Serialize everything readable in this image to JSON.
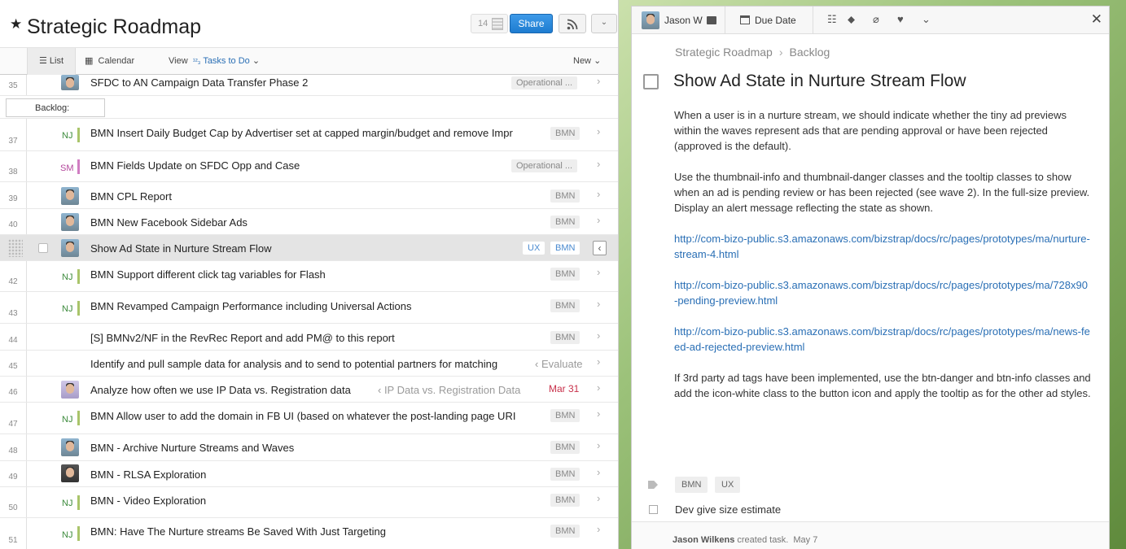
{
  "project": {
    "title": "Strategic Roadmap",
    "followers": "14",
    "share": "Share"
  },
  "toolbar": {
    "list": "List",
    "calendar": "Calendar",
    "view": "View",
    "view_filter": "Tasks to Do",
    "new": "New"
  },
  "section": {
    "backlog": "Backlog:"
  },
  "rows": [
    {
      "num": "35",
      "name": "SFDC to AN Campaign Data Transfer Phase 2",
      "tag": "Operational ..."
    },
    {
      "num": "37",
      "initials": "NJ",
      "name": "BMN Insert Daily Budget Cap by Advertiser set at capped margin/budget and remove Impr",
      "tag": "BMN"
    },
    {
      "num": "38",
      "initials": "SM",
      "name": "BMN Fields Update on SFDC Opp and Case",
      "tag": "Operational ..."
    },
    {
      "num": "39",
      "name": "BMN CPL Report",
      "tag": "BMN"
    },
    {
      "num": "40",
      "name": "BMN New Facebook Sidebar Ads",
      "tag": "BMN"
    },
    {
      "num": "",
      "name": "Show Ad State in Nurture Stream Flow",
      "tag_ux": "UX",
      "tag": "BMN"
    },
    {
      "num": "42",
      "initials": "NJ",
      "name": "BMN Support different click tag variables for Flash",
      "tag": "BMN"
    },
    {
      "num": "43",
      "initials": "NJ",
      "name": "BMN Revamped Campaign Performance including Universal Actions",
      "tag": "BMN"
    },
    {
      "num": "44",
      "name": "[S] BMNv2/NF in the RevRec Report and add PM@ to this report",
      "tag": "BMN"
    },
    {
      "num": "45",
      "name": "Identify and pull sample data for analysis and to send to potential partners for matching",
      "context": "‹ Evaluate"
    },
    {
      "num": "46",
      "name": "Analyze how often we use IP Data vs. Registration data",
      "context": "‹ IP Data vs. Registration Data",
      "date": "Mar 31"
    },
    {
      "num": "47",
      "initials": "NJ",
      "name": "BMN Allow user to add the domain in FB UI (based on whatever the post-landing page URI",
      "tag": "BMN"
    },
    {
      "num": "48",
      "name": "BMN - Archive Nurture Streams and Waves",
      "tag": "BMN"
    },
    {
      "num": "49",
      "name": "BMN - RLSA Exploration",
      "tag": "BMN"
    },
    {
      "num": "50",
      "initials": "NJ",
      "name": "BMN - Video Exploration",
      "tag": "BMN"
    },
    {
      "num": "51",
      "initials": "NJ",
      "name": "BMN: Have The Nurture streams Be Saved With Just Targeting",
      "tag": "BMN"
    }
  ],
  "detail": {
    "assignee": "Jason W",
    "due_date": "Due Date",
    "breadcrumb_project": "Strategic Roadmap",
    "breadcrumb_section": "Backlog",
    "title": "Show Ad State in Nurture Stream Flow",
    "p1": "When a user is in a nurture stream, we should indicate whether the tiny ad previews within the waves represent ads that are pending approval or have been rejected (approved is the default).",
    "p2": "Use the thumbnail-info and thumbnail-danger classes and the tooltip classes to show when an ad is pending review or has been rejected (see wave 2). In the full-size preview. Display an alert message reflecting the state as shown.",
    "link1": "http://com-bizo-public.s3.amazonaws.com/bizstrap/docs/rc/pages/prototypes/ma/nurture-stream-4.html",
    "link2": "http://com-bizo-public.s3.amazonaws.com/bizstrap/docs/rc/pages/prototypes/ma/728x90-pending-preview.html",
    "link3": "http://com-bizo-public.s3.amazonaws.com/bizstrap/docs/rc/pages/prototypes/ma/news-feed-ad-rejected-preview.html",
    "p3": "If 3rd party ad tags have been implemented, use the btn-danger and btn-info classes and add the icon-white class to the button icon and apply the tooltip as for the other ad styles.",
    "tags": [
      "BMN",
      "UX"
    ],
    "subtask": "Dev give size estimate",
    "activity_user": "Jason Wilkens",
    "activity_text": "created task.",
    "activity_date": "May 7"
  }
}
